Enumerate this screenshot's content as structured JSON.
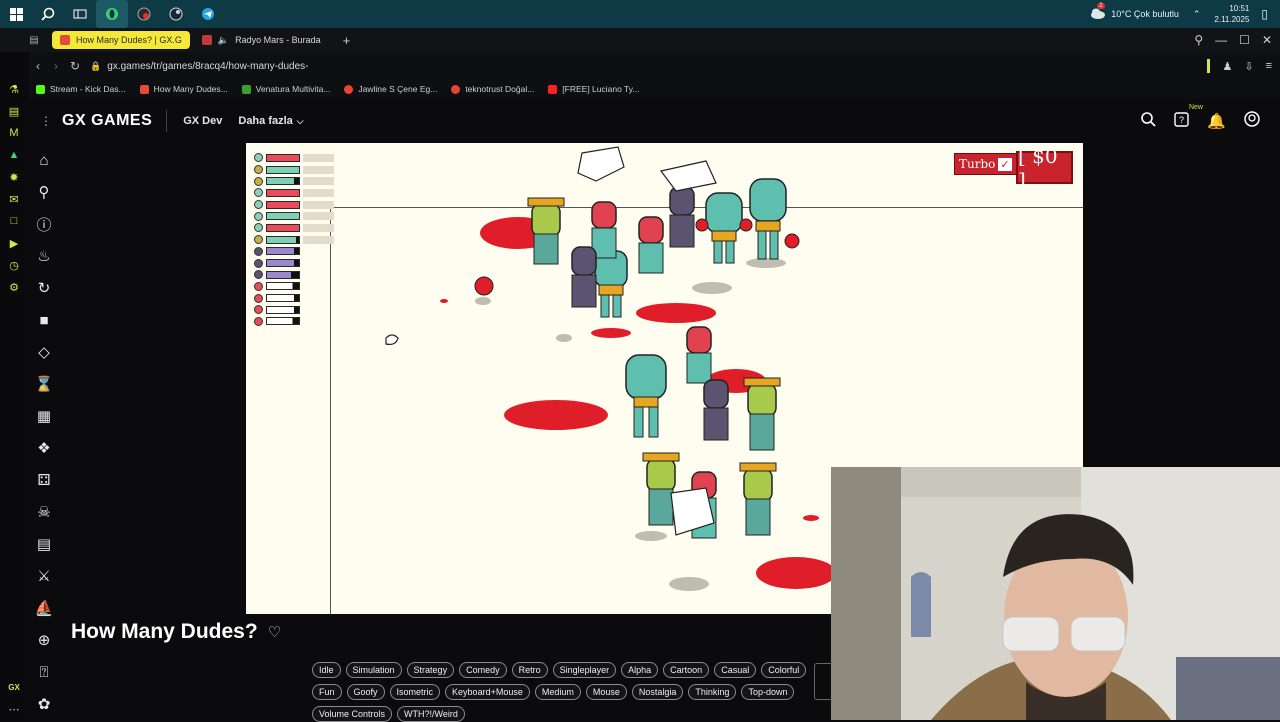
{
  "taskbar": {
    "icons": [
      "windows-icon",
      "search-icon",
      "task-view-icon",
      "opera-gx-icon",
      "record-icon",
      "steam-icon",
      "telegram-icon"
    ],
    "weather": "10°C  Çok bulutlu",
    "weather_badge": "2",
    "time": "10:51",
    "date": "2.11.2025"
  },
  "browser": {
    "tabs": [
      {
        "label": "How Many Dudes? | GX.G",
        "active": true
      },
      {
        "label": "Radyo Mars - Burada",
        "active": false
      }
    ],
    "new_tab_label": "+",
    "url": "gx.games/tr/games/8racq4/how-many-dudes-",
    "bookmarks": [
      {
        "label": "Stream - Kick Das...",
        "color": "#53fc18"
      },
      {
        "label": "How Many Dudes...",
        "color": "#e84a3a"
      },
      {
        "label": "Venatura Multivita...",
        "color": "#3c9e2c"
      },
      {
        "label": "Jawline S Çene Eg...",
        "color": "#e8442e"
      },
      {
        "label": "teknotrust Doğal...",
        "color": "#e8442e"
      },
      {
        "label": "[FREE] Luciano Ty...",
        "color": "#ff2020"
      }
    ]
  },
  "gx": {
    "logo": "GX GAMES",
    "nav": [
      "GX Dev",
      "Daha fazla"
    ],
    "new_badge": "New",
    "game_title": "How Many Dudes?",
    "tags": [
      "Idle",
      "Simulation",
      "Strategy",
      "Comedy",
      "Retro",
      "Singleplayer",
      "Alpha",
      "Cartoon",
      "Casual",
      "Colorful",
      "Fun",
      "Goofy",
      "Isometric",
      "Keyboard+Mouse",
      "Medium",
      "Mouse",
      "Nostalgia",
      "Thinking",
      "Top-down",
      "Volume Controls",
      "WTH?!/Weird"
    ]
  },
  "game": {
    "turbo_label": "Turbo",
    "money": "[ $0 ]",
    "hud_rows": [
      {
        "head": "#8fd0b8",
        "bar": "#e94b5a",
        "fill": 1.0
      },
      {
        "head": "#c7b04a",
        "bar": "#7fd1b5",
        "fill": 1.0
      },
      {
        "head": "#c7b04a",
        "bar": "#7fd1b5",
        "fill": 0.85
      },
      {
        "head": "#8fd0b8",
        "bar": "#e94b5a",
        "fill": 1.0
      },
      {
        "head": "#8fd0b8",
        "bar": "#e94b5a",
        "fill": 1.0
      },
      {
        "head": "#8fd0b8",
        "bar": "#7fd1b5",
        "fill": 1.0
      },
      {
        "head": "#8fd0b8",
        "bar": "#e94b5a",
        "fill": 1.0
      },
      {
        "head": "#c7b04a",
        "bar": "#7fd1b5",
        "fill": 0.9
      },
      {
        "head": "#5a5470",
        "bar": "#9a88d0",
        "fill": 0.85
      },
      {
        "head": "#5a5470",
        "bar": "#9a88d0",
        "fill": 0.85
      },
      {
        "head": "#5a5470",
        "bar": "#9a88d0",
        "fill": 0.75
      },
      {
        "head": "#e94b5a",
        "bar": "#ffffff",
        "fill": 0.8
      },
      {
        "head": "#e94b5a",
        "bar": "#ffffff",
        "fill": 0.85
      },
      {
        "head": "#e94b5a",
        "bar": "#ffffff",
        "fill": 0.85
      },
      {
        "head": "#e94b5a",
        "bar": "#ffffff",
        "fill": 0.8
      }
    ]
  }
}
